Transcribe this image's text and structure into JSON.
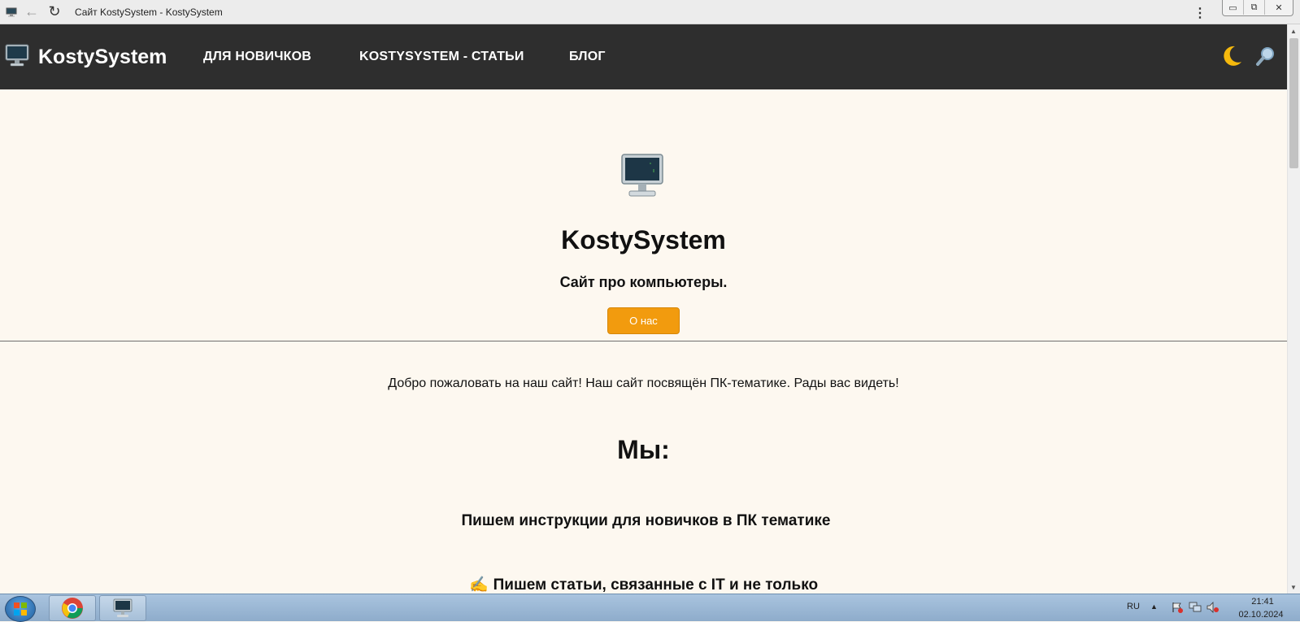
{
  "browser": {
    "tab_title": "Сайт KostySystem - KostySystem",
    "menu_glyph": "⋮",
    "back_glyph": "←",
    "reload_glyph": "↻"
  },
  "window_controls": {
    "minimize": "▭",
    "restore": "⧉",
    "close": "✕"
  },
  "header": {
    "logo_text": "KostySystem",
    "nav": [
      "ДЛЯ НОВИЧКОВ",
      "KOSTYSYSTEM - СТАТЬИ",
      "БЛОГ"
    ],
    "theme_toggle_icon": "moon-icon",
    "search_icon": "search-icon"
  },
  "hero": {
    "title": "KostySystem",
    "subtitle": "Сайт про компьютеры.",
    "about_button": "О нас"
  },
  "main": {
    "welcome": "Добро пожаловать на наш сайт! Наш сайт посвящён ПК-тематике. Рады вас видеть!",
    "we_heading": "Мы:",
    "features": [
      {
        "icon": "",
        "text": "Пишем инструкции для новичков в ПК тематике"
      },
      {
        "icon": "✍",
        "text": "Пишем статьи, связанные с IT и не только"
      }
    ]
  },
  "taskbar": {
    "language": "RU",
    "tray_arrow": "▲",
    "time": "21:41",
    "date": "02.10.2024"
  },
  "colors": {
    "header_bg": "#2e2e2e",
    "accent_button": "#f29b0e",
    "page_bg": "#fdf8f0",
    "moon": "#f5b90d"
  }
}
